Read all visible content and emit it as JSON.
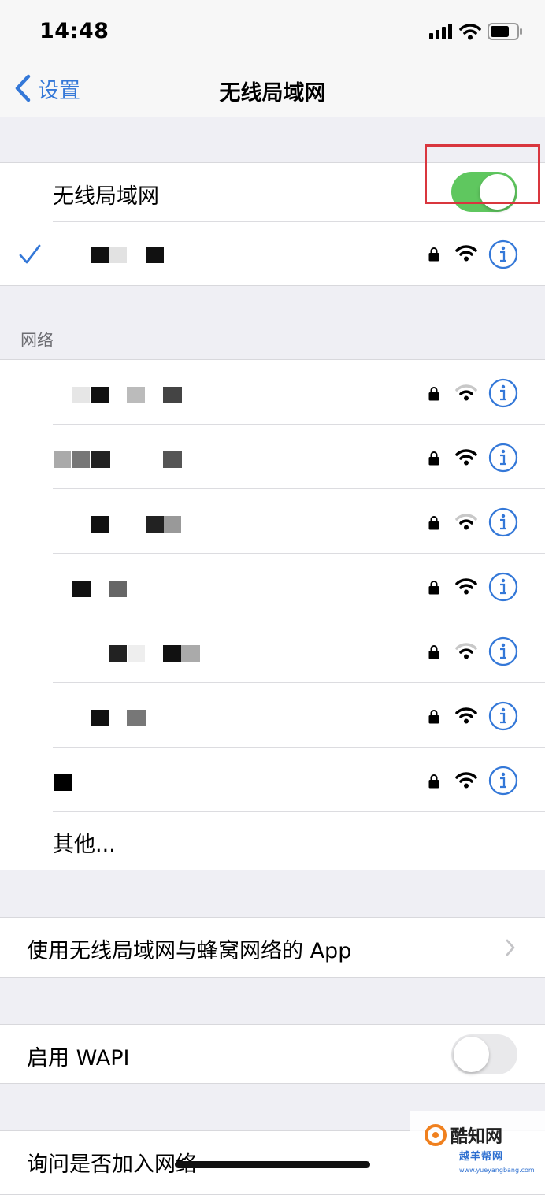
{
  "status_bar": {
    "time": "14:48"
  },
  "nav": {
    "back_label": "设置",
    "title": "无线局域网"
  },
  "wlan": {
    "label": "无线局域网",
    "enabled": true
  },
  "connected_network": {
    "ssid": "",
    "secured": true,
    "signal": "full"
  },
  "networks_section": {
    "header": "网络",
    "networks": [
      {
        "ssid": "",
        "secured": true,
        "signal": "weak"
      },
      {
        "ssid": "",
        "secured": true,
        "signal": "full"
      },
      {
        "ssid": "",
        "secured": true,
        "signal": "weak"
      },
      {
        "ssid": "",
        "secured": true,
        "signal": "full"
      },
      {
        "ssid": "",
        "secured": true,
        "signal": "weak"
      },
      {
        "ssid": "",
        "secured": true,
        "signal": "full"
      },
      {
        "ssid": "",
        "secured": true,
        "signal": "full"
      }
    ],
    "other_label": "其他..."
  },
  "apps_row": {
    "label": "使用无线局域网与蜂窝网络的 App"
  },
  "wapi": {
    "label": "启用 WAPI",
    "enabled": false
  },
  "ask_join": {
    "label": "询问是否加入网络"
  },
  "watermark": {
    "name": "酷知网",
    "sub": "越羊帮网",
    "url": "www.yueyangbang.com"
  },
  "colors": {
    "accent": "#3478d8",
    "toggle_on": "#5fc75f",
    "highlight": "#d9363e"
  },
  "icons": [
    "chevron-left-icon",
    "checkmark-icon",
    "lock-icon",
    "wifi-icon",
    "info-icon",
    "chevron-right-icon",
    "signal-icon",
    "battery-icon"
  ]
}
